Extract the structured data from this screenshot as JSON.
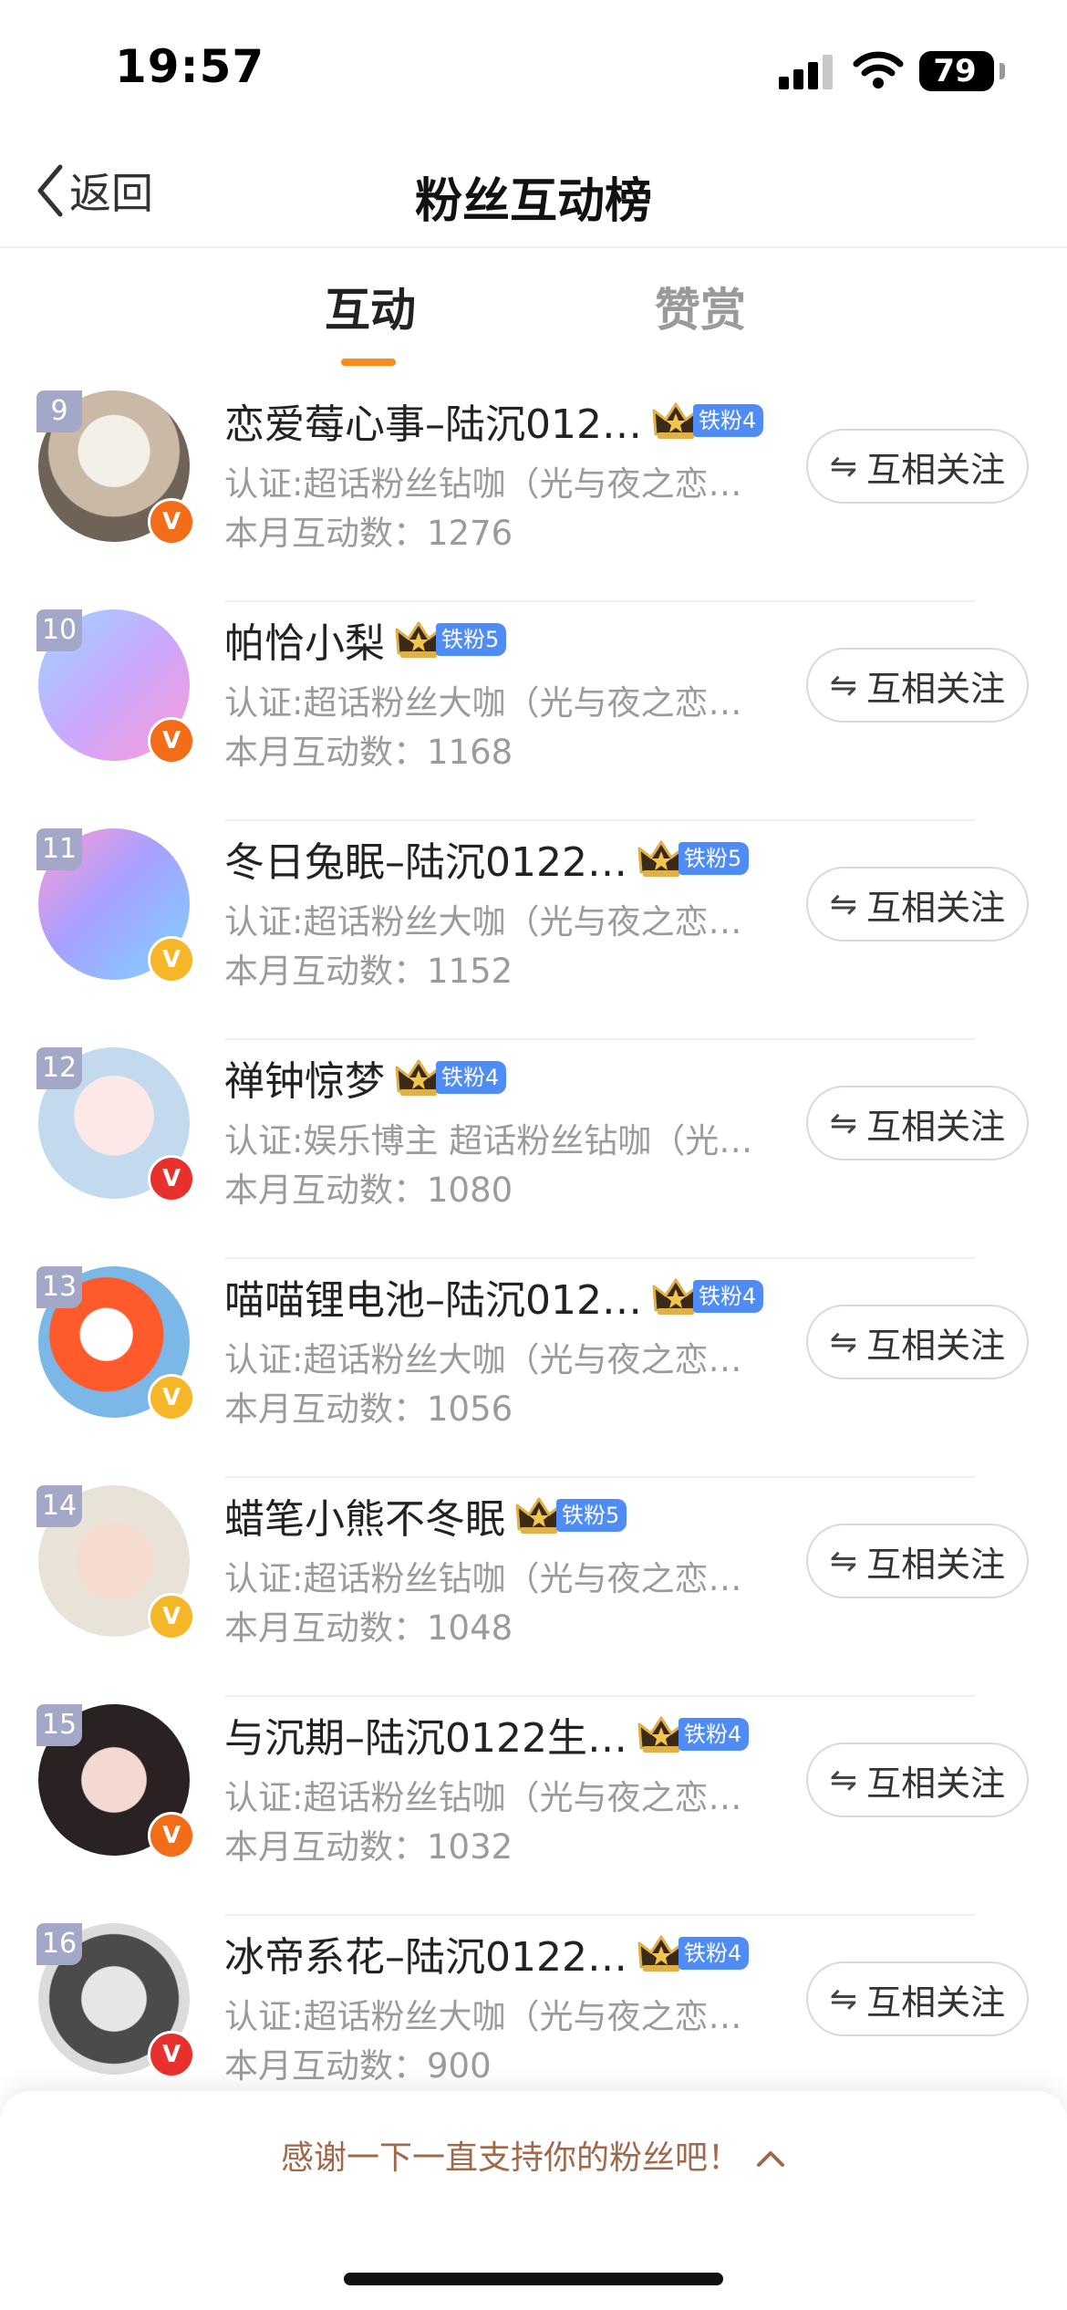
{
  "status_bar": {
    "time": "19:57",
    "battery": "79"
  },
  "nav": {
    "back_label": "返回",
    "title": "粉丝互动榜"
  },
  "tabs": [
    {
      "label": "互动",
      "active": true
    },
    {
      "label": "赞赏",
      "active": false
    }
  ],
  "colors": {
    "accent": "#ff8a1f",
    "rank_badge": "#a3a8c9",
    "fan_badge": "#4f8cf5",
    "sheet_text": "#a0694a"
  },
  "rows": [
    {
      "rank": "9",
      "name": "恋爱莓心事–陆沉012…",
      "badge": "铁粉4",
      "cert": "认证:超话粉丝钻咖（光与夜之恋陆…",
      "count": "本月互动数：1276",
      "follow": "互相关注",
      "v": "orange"
    },
    {
      "rank": "10",
      "name": "帕恰小梨",
      "badge": "铁粉5",
      "cert": "认证:超话粉丝大咖（光与夜之恋陆…",
      "count": "本月互动数：1168",
      "follow": "互相关注",
      "v": "orange"
    },
    {
      "rank": "11",
      "name": "冬日兔眠–陆沉0122…",
      "badge": "铁粉5",
      "cert": "认证:超话粉丝大咖（光与夜之恋陆…",
      "count": "本月互动数：1152",
      "follow": "互相关注",
      "v": "gold"
    },
    {
      "rank": "12",
      "name": "禅钟惊梦",
      "badge": "铁粉4",
      "cert": "认证:娱乐博主 超话粉丝钻咖（光与…",
      "count": "本月互动数：1080",
      "follow": "互相关注",
      "v": "red"
    },
    {
      "rank": "13",
      "name": "喵喵锂电池–陆沉012…",
      "badge": "铁粉4",
      "cert": "认证:超话粉丝大咖（光与夜之恋陆…",
      "count": "本月互动数：1056",
      "follow": "互相关注",
      "v": "gold"
    },
    {
      "rank": "14",
      "name": "蜡笔小熊不冬眠",
      "badge": "铁粉5",
      "cert": "认证:超话粉丝钻咖（光与夜之恋陆…",
      "count": "本月互动数：1048",
      "follow": "互相关注",
      "v": "gold"
    },
    {
      "rank": "15",
      "name": "与沉期–陆沉0122生…",
      "badge": "铁粉4",
      "cert": "认证:超话粉丝钻咖（光与夜之恋陆…",
      "count": "本月互动数：1032",
      "follow": "互相关注",
      "v": "orange"
    },
    {
      "rank": "16",
      "name": "冰帝系花–陆沉0122…",
      "badge": "铁粉4",
      "cert": "认证:超话粉丝大咖（光与夜之恋陆…",
      "count": "本月互动数：900",
      "follow": "互相关注",
      "v": "red"
    }
  ],
  "sheet": {
    "text": "感谢一下一直支持你的粉丝吧！"
  }
}
